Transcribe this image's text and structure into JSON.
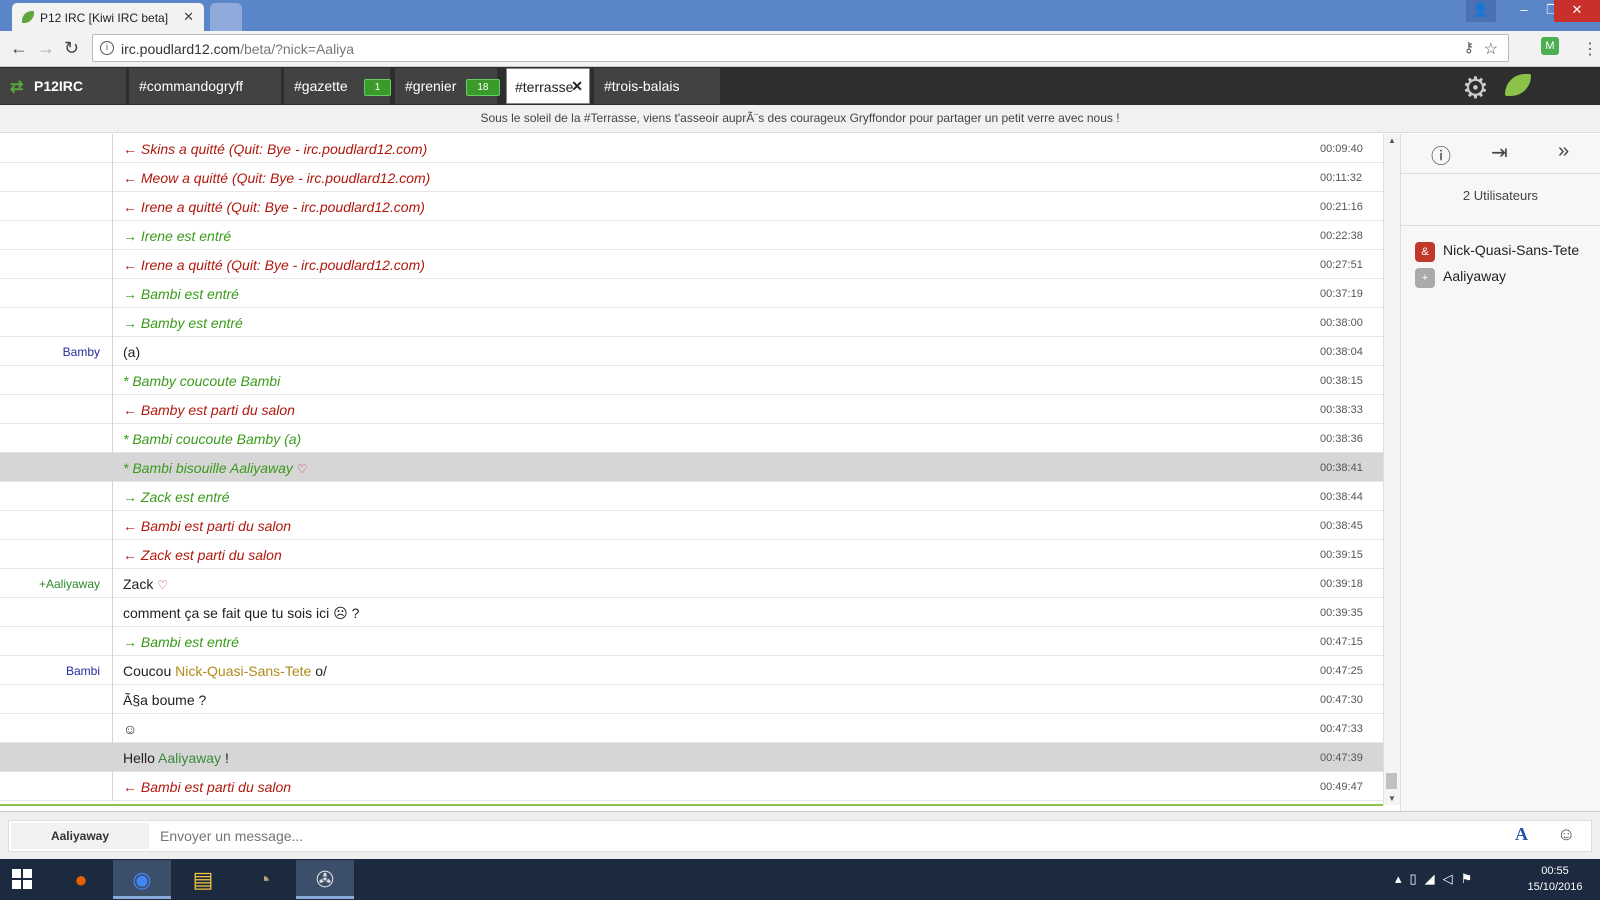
{
  "browser": {
    "tab_title": "P12 IRC [Kiwi IRC beta]",
    "url_host": "irc.poudlard12.com",
    "url_path": "/beta/?nick=Aaliya"
  },
  "irc": {
    "server_tab": "P12IRC",
    "channels": [
      {
        "name": "#commandogryff",
        "badge": ""
      },
      {
        "name": "#gazette",
        "badge": "1"
      },
      {
        "name": "#grenier",
        "badge": "18"
      },
      {
        "name": "#terrasse",
        "badge": ""
      },
      {
        "name": "#trois-balais",
        "badge": ""
      }
    ],
    "topic": "Sous le soleil de la #Terrasse, viens t'asseoir auprÃ¨s des courageux Gryffondor pour partager un petit verre avec nous !",
    "messages": [
      {
        "nick": "",
        "text": "← Skins a quitté (Quit: Bye - irc.poudlard12.com)",
        "time": "00:09:40"
      },
      {
        "nick": "",
        "text": "← Meow a quitté (Quit: Bye - irc.poudlard12.com)",
        "time": "00:11:32"
      },
      {
        "nick": "",
        "text": "← Irene a quitté (Quit: Bye - irc.poudlard12.com)",
        "time": "00:21:16"
      },
      {
        "nick": "",
        "text": "→ Irene est entré",
        "time": "00:22:38"
      },
      {
        "nick": "",
        "text": "← Irene a quitté (Quit: Bye - irc.poudlard12.com)",
        "time": "00:27:51"
      },
      {
        "nick": "",
        "text": "→ Bambi est entré",
        "time": "00:37:19"
      },
      {
        "nick": "",
        "text": "→ Bamby est entré",
        "time": "00:38:00"
      },
      {
        "nick": "Bamby",
        "text": "(a)",
        "time": "00:38:04"
      },
      {
        "nick": "",
        "text": "* Bamby coucoute Bambi",
        "time": "00:38:15"
      },
      {
        "nick": "",
        "text": "← Bamby est parti du salon",
        "time": "00:38:33"
      },
      {
        "nick": "",
        "text": "* Bambi coucoute Bamby (a)",
        "time": "00:38:36"
      },
      {
        "nick": "",
        "text": "* Bambi bisouille Aaliyaway",
        "time": "00:38:41"
      },
      {
        "nick": "",
        "text": "→ Zack est entré",
        "time": "00:38:44"
      },
      {
        "nick": "",
        "text": "← Bambi est parti du salon",
        "time": "00:38:45"
      },
      {
        "nick": "",
        "text": "← Zack est parti du salon",
        "time": "00:39:15"
      },
      {
        "nick": "+Aaliyaway",
        "text": "Zack",
        "time": "00:39:18"
      },
      {
        "nick": "",
        "text": "comment ça se fait que tu sois ici",
        "text_after": "?",
        "time": "00:39:35"
      },
      {
        "nick": "",
        "text": "→ Bambi est entré",
        "time": "00:47:15"
      },
      {
        "nick": "Bambi",
        "text": "Coucou",
        "mention": "Nick-Quasi-Sans-Tete",
        "text_after": "o/",
        "time": "00:47:25"
      },
      {
        "nick": "",
        "text": "Ã§a boume ?",
        "time": "00:47:30"
      },
      {
        "nick": "",
        "text": "",
        "time": "00:47:33"
      },
      {
        "nick": "",
        "text": "Hello",
        "mention": "Aaliyaway",
        "text_after": "!",
        "time": "00:47:39"
      },
      {
        "nick": "",
        "text": "← Bambi est parti du salon",
        "time": "00:49:47"
      }
    ],
    "user_count": "2 Utilisateurs",
    "users": [
      {
        "mode": "&",
        "name": "Nick-Quasi-Sans-Tete",
        "color": "#c0392b"
      },
      {
        "mode": "+",
        "name": "Aaliyaway",
        "color": "#aaaaaa"
      }
    ],
    "my_nick": "Aaliyaway",
    "input_placeholder": "Envoyer un message..."
  },
  "taskbar": {
    "time": "00:55",
    "date": "15/10/2016"
  },
  "colors": {
    "quit": "#b0180e",
    "join": "#3a9a1a",
    "accent": "#8bc34a"
  }
}
